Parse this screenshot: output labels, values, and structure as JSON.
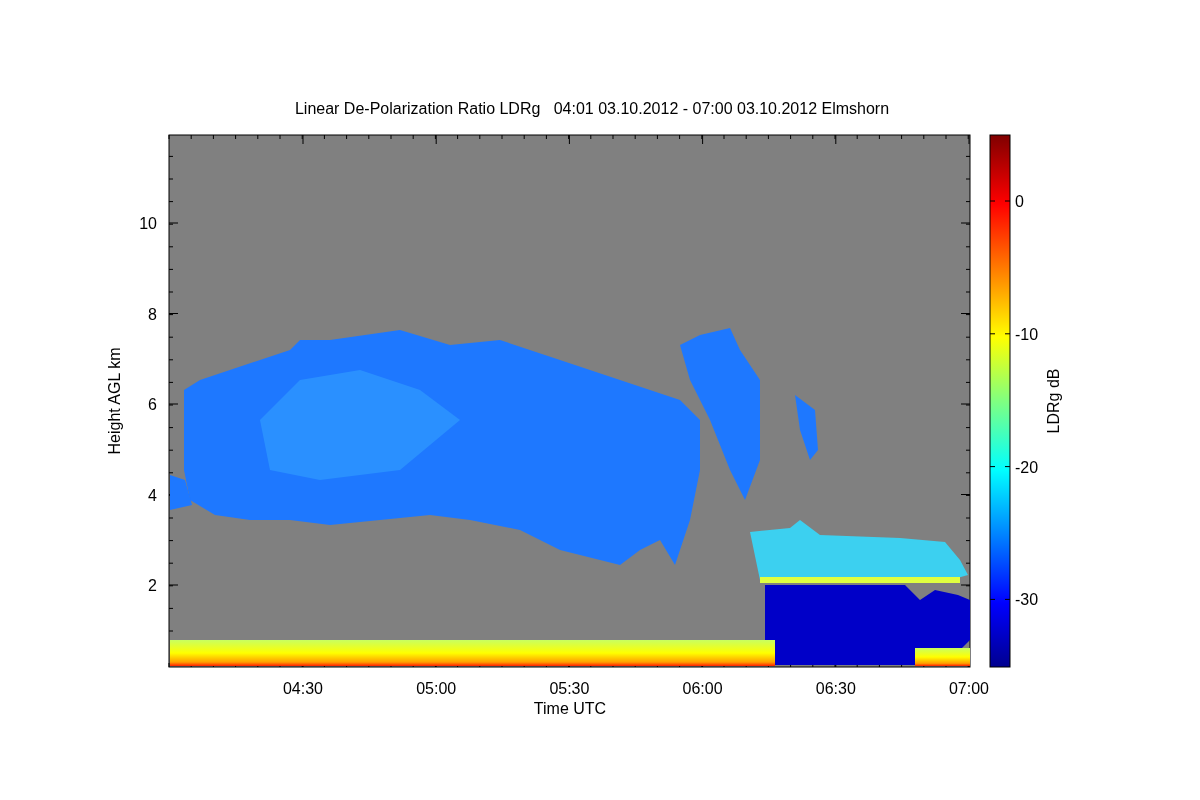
{
  "title": "Linear De-Polarization Ratio LDRg   04:01 03.10.2012 - 07:00 03.10.2012 Elmshorn",
  "x_axis": {
    "label": "Time UTC",
    "ticks": [
      "04:30",
      "05:00",
      "05:30",
      "06:00",
      "06:30",
      "07:00"
    ]
  },
  "y_axis": {
    "label": "Height AGL km",
    "ticks": [
      "10",
      "8",
      "6",
      "4",
      "2"
    ]
  },
  "colorbar": {
    "label": "LDRg dB",
    "ticks": [
      "0",
      "-10",
      "-20",
      "-30"
    ]
  }
}
